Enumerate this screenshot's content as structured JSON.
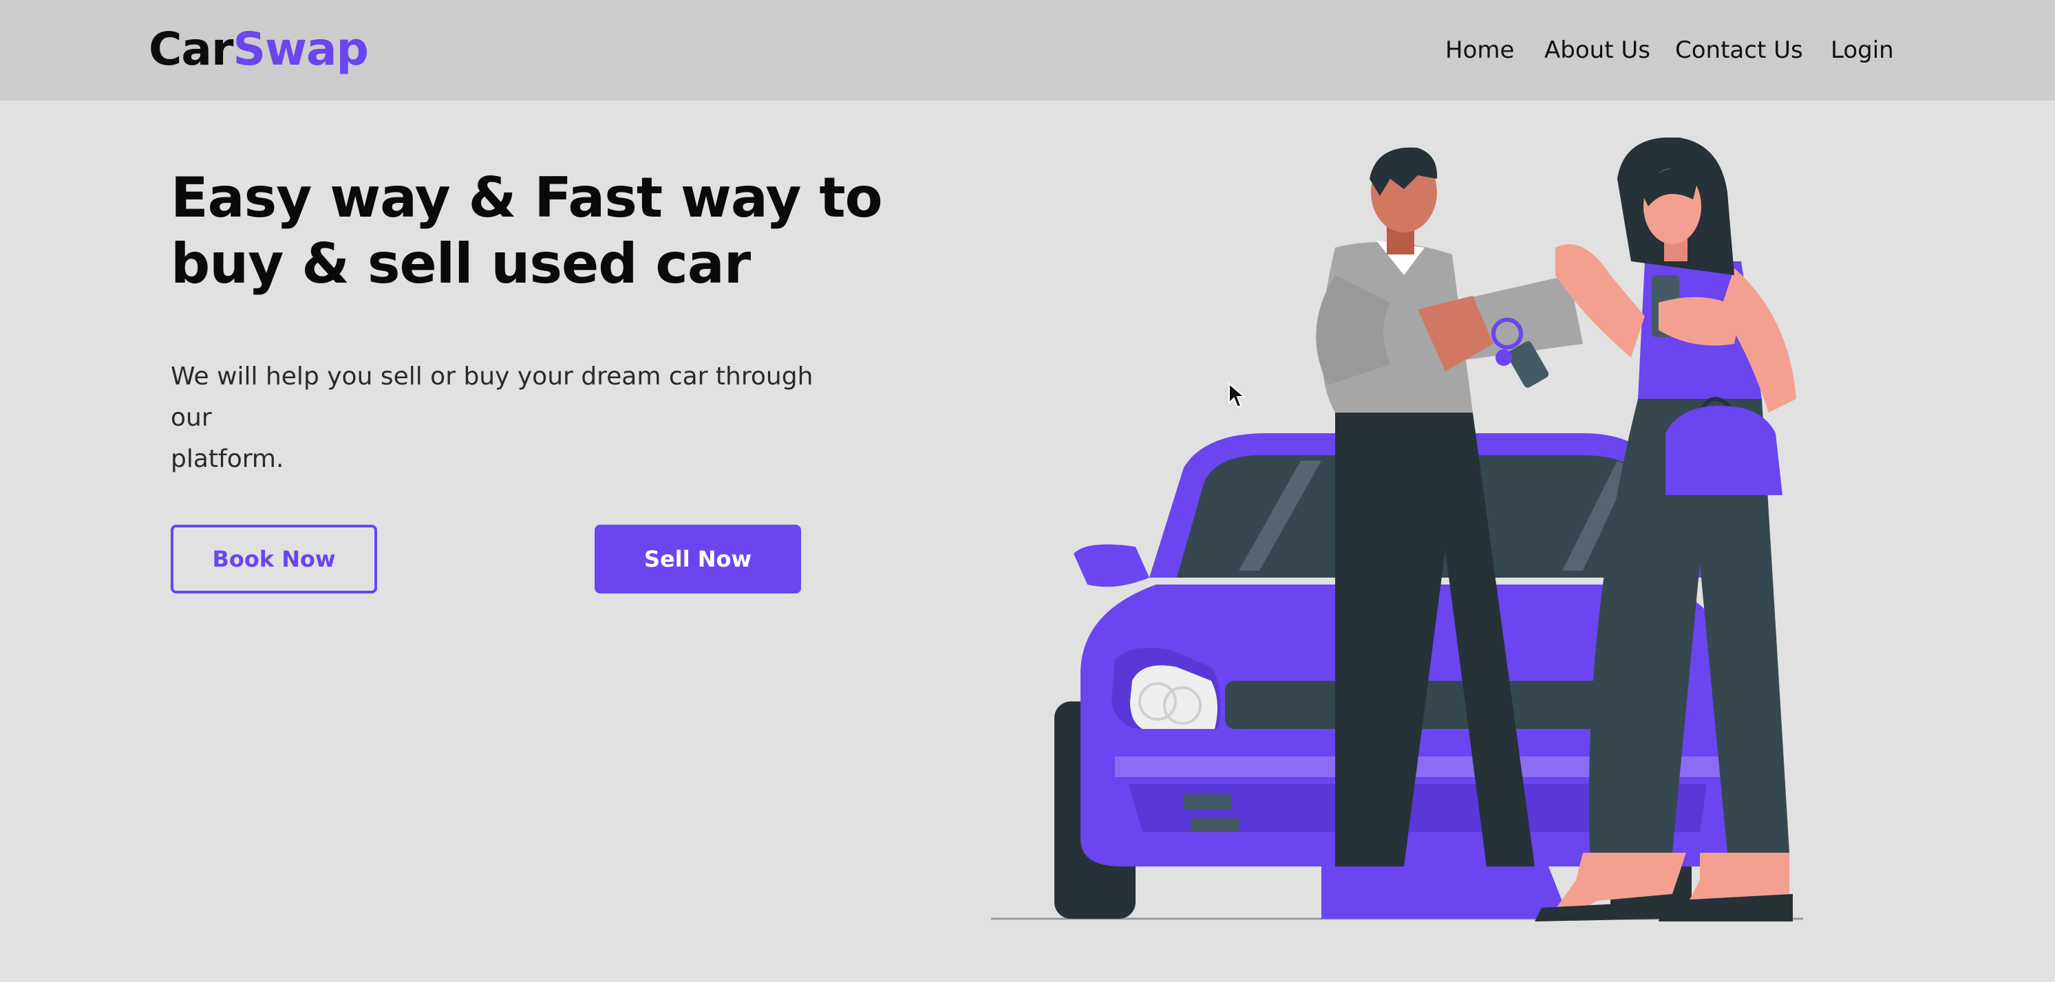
{
  "brand": {
    "part1": "Car",
    "part2": "Swap"
  },
  "nav": {
    "home": "Home",
    "about": "About Us",
    "contact": "Contact Us",
    "login": "Login"
  },
  "hero": {
    "title_line1": "Easy way & Fast way to",
    "title_line2": "buy & sell used car",
    "subtitle_line1": "We will help you sell or buy your dream car through our",
    "subtitle_line2": "platform."
  },
  "buttons": {
    "book": "Book Now",
    "sell": "Sell Now"
  },
  "colors": {
    "accent": "#6a45f0",
    "navbar_bg": "#cccccc",
    "page_bg": "#e1e1e1"
  },
  "icons": {
    "cursor": "mouse-pointer-icon",
    "illustration": "people-exchanging-car-keys-illustration"
  }
}
